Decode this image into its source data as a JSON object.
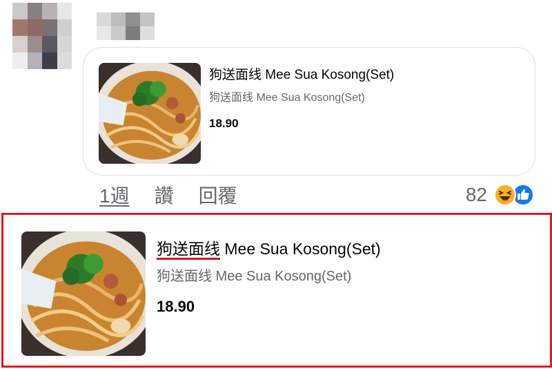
{
  "comment": {
    "product": {
      "title_zh": "狗送面线",
      "title_en": "Mee Sua Kosong(Set)",
      "subtitle": "狗送面线 Mee Sua Kosong(Set)",
      "price": "18.90"
    },
    "actions": {
      "time": "1週",
      "like": "讚",
      "reply": "回覆"
    },
    "reactions": {
      "count": "82",
      "icons": [
        "haha-icon",
        "like-icon"
      ]
    }
  },
  "highlighted_product": {
    "title_zh": "狗送面线",
    "title_en": "Mee Sua Kosong(Set)",
    "subtitle": "狗送面线 Mee Sua Kosong(Set)",
    "price": "18.90"
  },
  "colors": {
    "highlight_border": "#e0181f",
    "underline": "#d2161e",
    "secondary_text": "#65676b",
    "like_blue": "#1877f2",
    "haha_yellow": "#f7b125"
  }
}
